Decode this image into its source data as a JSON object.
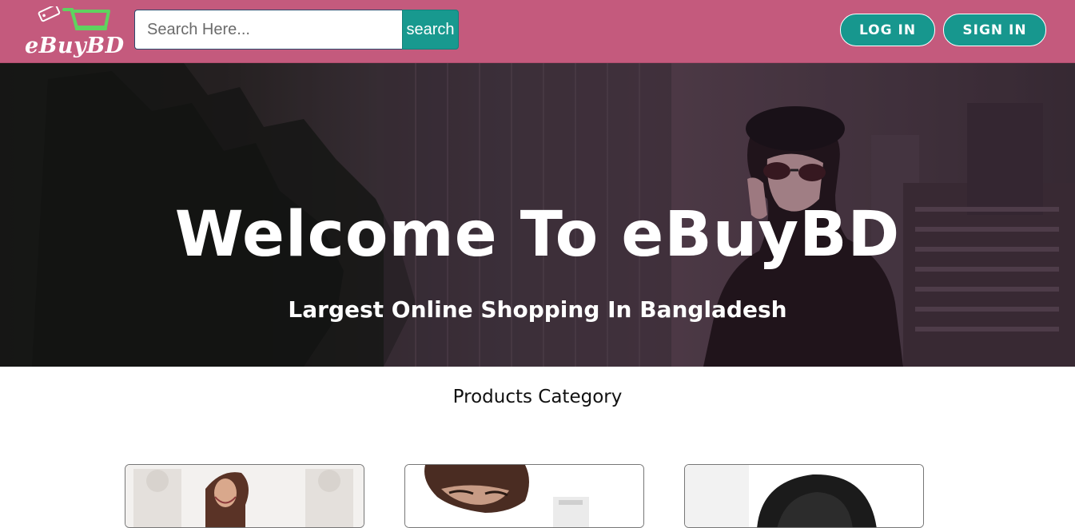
{
  "header": {
    "logo_text": "eBuyBD",
    "search": {
      "placeholder": "Search Here...",
      "value": "",
      "button_label": "search"
    },
    "login_label": "LOG IN",
    "signin_label": "SIGN IN"
  },
  "hero": {
    "title": "Welcome To eBuyBD",
    "subtitle": "Largest Online Shopping In Bangladesh"
  },
  "categories": {
    "title": "Products Category",
    "cards": [
      {
        "icon": "fashion-model-image"
      },
      {
        "icon": "beauty-product-image"
      },
      {
        "icon": "bag-product-image"
      }
    ]
  },
  "colors": {
    "header_bg": "#c45a7d",
    "accent": "#17978e",
    "logo_cart": "#5fd35f"
  }
}
